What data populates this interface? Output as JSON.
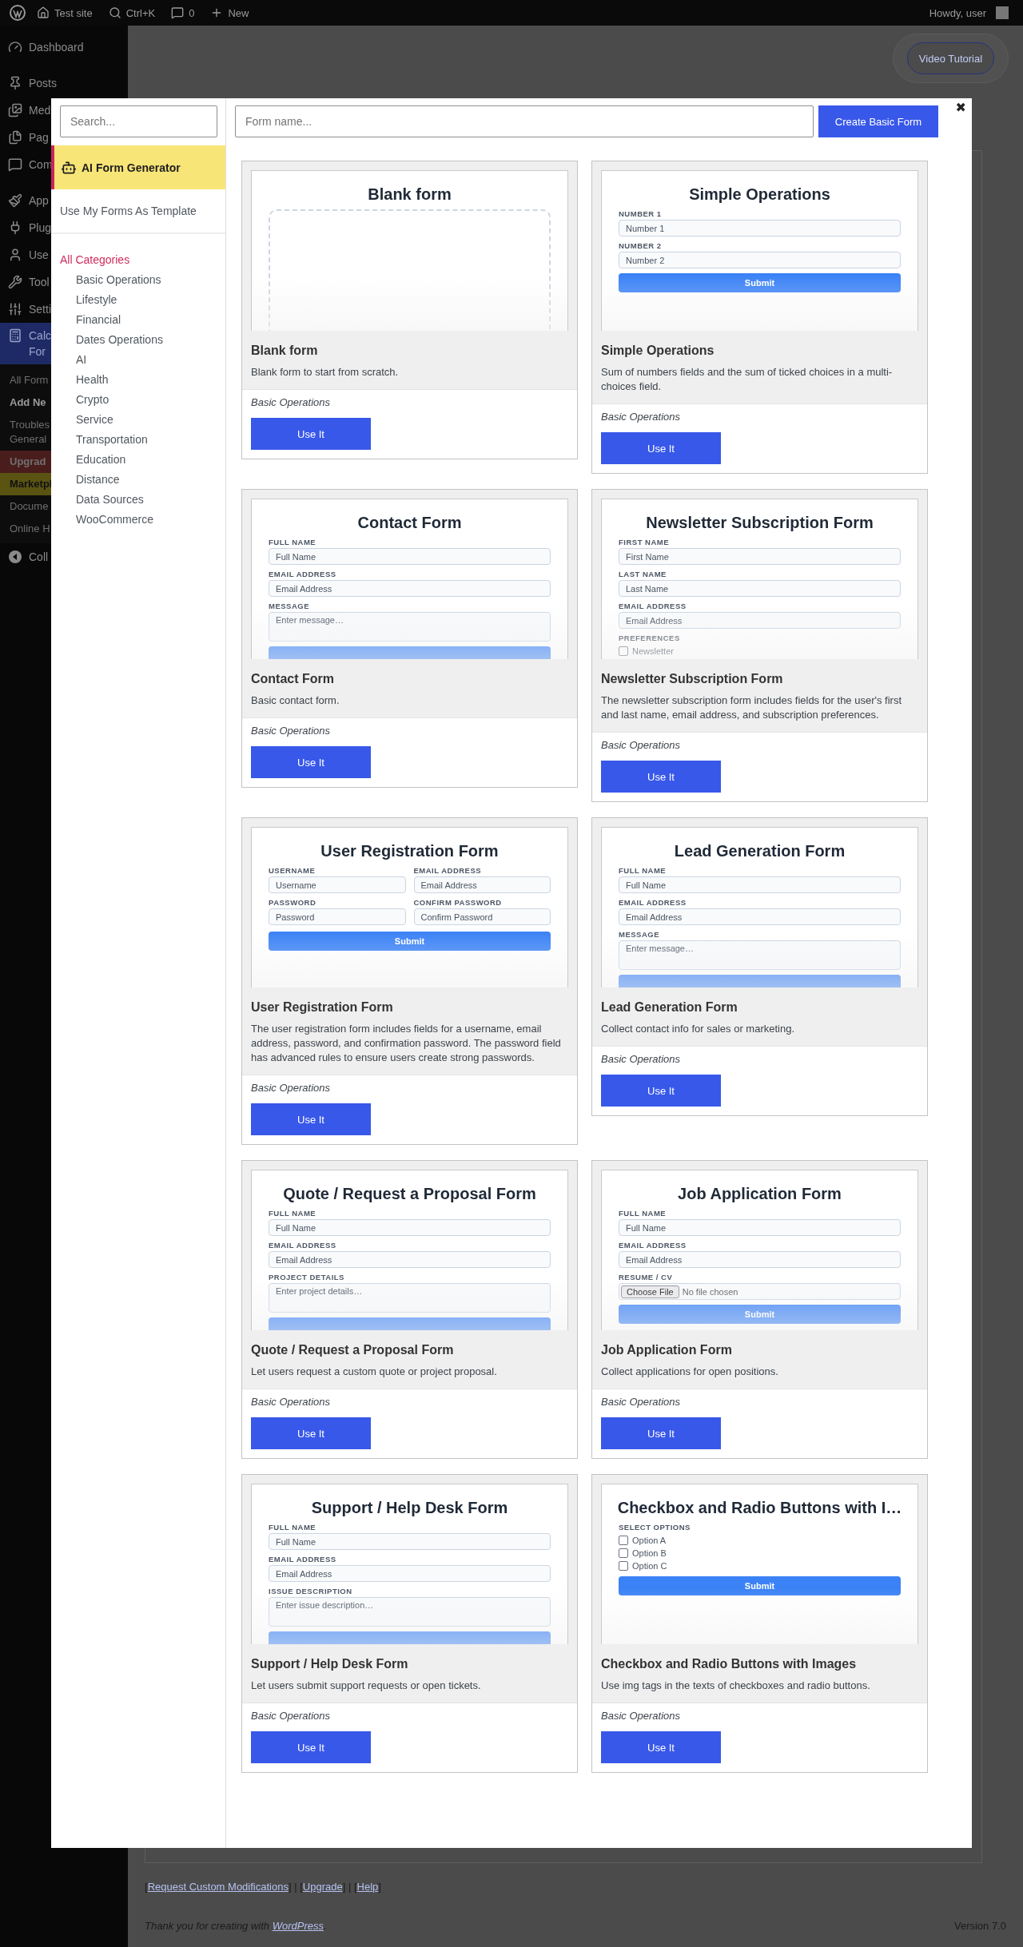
{
  "admin_bar": {
    "site": "Test site",
    "search": "Ctrl+K",
    "comments": "0",
    "new": "New",
    "greeting": "Howdy, user"
  },
  "admin_menu": {
    "groups": [
      [
        {
          "label": "Dashboard",
          "selected": false
        }
      ],
      [
        {
          "label": "Posts",
          "selected": false
        },
        {
          "label": "Med",
          "selected": false
        },
        {
          "label": "Pag",
          "selected": false
        },
        {
          "label": "Com",
          "selected": false
        }
      ],
      [
        {
          "label": "App",
          "selected": false
        },
        {
          "label": "Plug",
          "selected": false
        },
        {
          "label": "Use",
          "selected": false
        },
        {
          "label": "Tool",
          "selected": false
        },
        {
          "label": "Setti",
          "selected": false
        },
        {
          "label": "Calc\nFor",
          "selected": true
        }
      ]
    ],
    "submenu": [
      {
        "kind": "plain",
        "label": "All Form"
      },
      {
        "kind": "current",
        "label": "Add Ne"
      },
      {
        "kind": "plain",
        "label": "Troubles\nGeneral"
      },
      {
        "kind": "upgrade",
        "label": "Upgrad"
      },
      {
        "kind": "marketplace",
        "label": "Marketpl"
      },
      {
        "kind": "plain",
        "label": "Docume"
      },
      {
        "kind": "plain",
        "label": "Online H"
      }
    ],
    "collapse": "Coll"
  },
  "video_tutorial": "Video Tutorial",
  "modal": {
    "search": {
      "placeholder": "Search..."
    },
    "form_name": {
      "placeholder": "Form name..."
    },
    "create_button": "Create Basic Form",
    "close": "✖",
    "ai_generator": "AI Form Generator",
    "my_forms": "Use My Forms As Template",
    "categories": [
      {
        "label": "All Categories",
        "selected": true
      },
      {
        "label": "Basic Operations",
        "selected": false
      },
      {
        "label": "Lifestyle",
        "selected": false
      },
      {
        "label": "Financial",
        "selected": false
      },
      {
        "label": "Dates Operations",
        "selected": false
      },
      {
        "label": "AI",
        "selected": false
      },
      {
        "label": "Health",
        "selected": false
      },
      {
        "label": "Crypto",
        "selected": false
      },
      {
        "label": "Service",
        "selected": false
      },
      {
        "label": "Transportation",
        "selected": false
      },
      {
        "label": "Education",
        "selected": false
      },
      {
        "label": "Distance",
        "selected": false
      },
      {
        "label": "Data Sources",
        "selected": false
      },
      {
        "label": "WooCommerce",
        "selected": false
      }
    ],
    "cards": [
      {
        "title": "Blank form",
        "description": "Blank form to start from scratch.",
        "category": "Basic Operations",
        "button": "Use It",
        "preview": {
          "kind": "blank",
          "title": "Blank form"
        }
      },
      {
        "title": "Simple Operations",
        "description": "Sum of numbers fields and the sum of ticked choices in a multi-choices field.",
        "category": "Basic Operations",
        "button": "Use It",
        "preview": {
          "kind": "form",
          "title": "Simple Operations",
          "items": [
            {
              "kind": "field",
              "label": "NUMBER 1",
              "placeholder": "Number 1"
            },
            {
              "kind": "field",
              "label": "NUMBER 2",
              "placeholder": "Number 2"
            },
            {
              "kind": "submit",
              "label": "Submit"
            }
          ]
        }
      },
      {
        "title": "Contact Form",
        "description": "Basic contact form.",
        "category": "Basic Operations",
        "button": "Use It",
        "preview": {
          "kind": "form",
          "title": "Contact Form",
          "items": [
            {
              "kind": "field",
              "label": "FULL NAME",
              "placeholder": "Full Name"
            },
            {
              "kind": "field",
              "label": "EMAIL ADDRESS",
              "placeholder": "Email Address"
            },
            {
              "kind": "textarea",
              "label": "MESSAGE",
              "placeholder": "Enter message…"
            },
            {
              "kind": "submit"
            }
          ]
        }
      },
      {
        "title": "Newsletter Subscription Form",
        "description": "The newsletter subscription form includes fields for the user's first and last name, email address, and subscription preferences.",
        "category": "Basic Operations",
        "button": "Use It",
        "preview": {
          "kind": "form",
          "title": "Newsletter Subscription Form",
          "items": [
            {
              "kind": "field",
              "label": "FIRST NAME",
              "placeholder": "First Name"
            },
            {
              "kind": "field",
              "label": "LAST NAME",
              "placeholder": "Last Name"
            },
            {
              "kind": "field",
              "label": "EMAIL ADDRESS",
              "placeholder": "Email Address"
            },
            {
              "kind": "checks",
              "label": "PREFERENCES",
              "options": [
                {
                  "label": "Newsletter",
                  "checked": false
                }
              ]
            }
          ]
        }
      },
      {
        "title": "User Registration Form",
        "description": "The user registration form includes fields for a username, email address, password, and confirmation password. The password field has advanced rules to ensure users create strong passwords.",
        "category": "Basic Operations",
        "button": "Use It",
        "preview": {
          "kind": "form",
          "title": "User Registration Form",
          "items": [
            {
              "kind": "pair",
              "fields": [
                {
                  "label": "USERNAME",
                  "placeholder": "Username"
                },
                {
                  "label": "EMAIL ADDRESS",
                  "placeholder": "Email Address"
                }
              ]
            },
            {
              "kind": "pair",
              "fields": [
                {
                  "label": "PASSWORD",
                  "placeholder": "Password"
                },
                {
                  "label": "CONFIRM PASSWORD",
                  "placeholder": "Confirm Password"
                }
              ]
            },
            {
              "kind": "submit",
              "label": "Submit"
            }
          ]
        }
      },
      {
        "title": "Lead Generation Form",
        "description": "Collect contact info for sales or marketing.",
        "category": "Basic Operations",
        "button": "Use It",
        "preview": {
          "kind": "form",
          "title": "Lead Generation Form",
          "items": [
            {
              "kind": "field",
              "label": "FULL NAME",
              "placeholder": "Full Name"
            },
            {
              "kind": "field",
              "label": "EMAIL ADDRESS",
              "placeholder": "Email Address"
            },
            {
              "kind": "textarea",
              "label": "MESSAGE",
              "placeholder": "Enter message…"
            },
            {
              "kind": "submit"
            }
          ]
        }
      },
      {
        "title": "Quote / Request a Proposal Form",
        "description": "Let users request a custom quote or project proposal.",
        "category": "Basic Operations",
        "button": "Use It",
        "preview": {
          "kind": "form",
          "title": "Quote / Request a Proposal Form",
          "items": [
            {
              "kind": "field",
              "label": "FULL NAME",
              "placeholder": "Full Name"
            },
            {
              "kind": "field",
              "label": "EMAIL ADDRESS",
              "placeholder": "Email Address"
            },
            {
              "kind": "textarea",
              "label": "PROJECT DETAILS",
              "placeholder": "Enter project details…"
            },
            {
              "kind": "submit"
            }
          ]
        }
      },
      {
        "title": "Job Application Form",
        "description": "Collect applications for open positions.",
        "category": "Basic Operations",
        "button": "Use It",
        "preview": {
          "kind": "form",
          "title": "Job Application Form",
          "items": [
            {
              "kind": "field",
              "label": "FULL NAME",
              "placeholder": "Full Name"
            },
            {
              "kind": "field",
              "label": "EMAIL ADDRESS",
              "placeholder": "Email Address"
            },
            {
              "kind": "file",
              "label": "RESUME / CV",
              "button": "Choose File",
              "status": "No file chosen"
            },
            {
              "kind": "submit",
              "label": "Submit"
            }
          ]
        }
      },
      {
        "title": "Support / Help Desk Form",
        "description": "Let users submit support requests or open tickets.",
        "category": "Basic Operations",
        "button": "Use It",
        "preview": {
          "kind": "form",
          "title": "Support / Help Desk Form",
          "items": [
            {
              "kind": "field",
              "label": "FULL NAME",
              "placeholder": "Full Name"
            },
            {
              "kind": "field",
              "label": "EMAIL ADDRESS",
              "placeholder": "Email Address"
            },
            {
              "kind": "textarea",
              "label": "ISSUE DESCRIPTION",
              "placeholder": "Enter issue description…"
            },
            {
              "kind": "submit"
            }
          ]
        }
      },
      {
        "title": "Checkbox and Radio Buttons with Images",
        "description": "Use img tags in the texts of checkboxes and radio buttons.",
        "category": "Basic Operations",
        "button": "Use It",
        "preview": {
          "kind": "form",
          "title": "Checkbox and Radio Buttons with I…",
          "items": [
            {
              "kind": "checks",
              "label": "SELECT OPTIONS",
              "options": [
                {
                  "label": "Option A",
                  "checked": false
                },
                {
                  "label": "Option B",
                  "checked": false
                },
                {
                  "label": "Option C",
                  "checked": false
                }
              ]
            },
            {
              "kind": "submit",
              "label": "Submit"
            }
          ]
        }
      }
    ]
  },
  "footer": {
    "open": "[",
    "close": "]",
    "separator": " | ",
    "links": [
      "Request Custom Modifications",
      "Upgrade",
      "Help"
    ],
    "thanks": "Thank you for creating with",
    "thanks_link": "WordPress",
    "thanks_end": ".",
    "version": "Version 7.0"
  }
}
